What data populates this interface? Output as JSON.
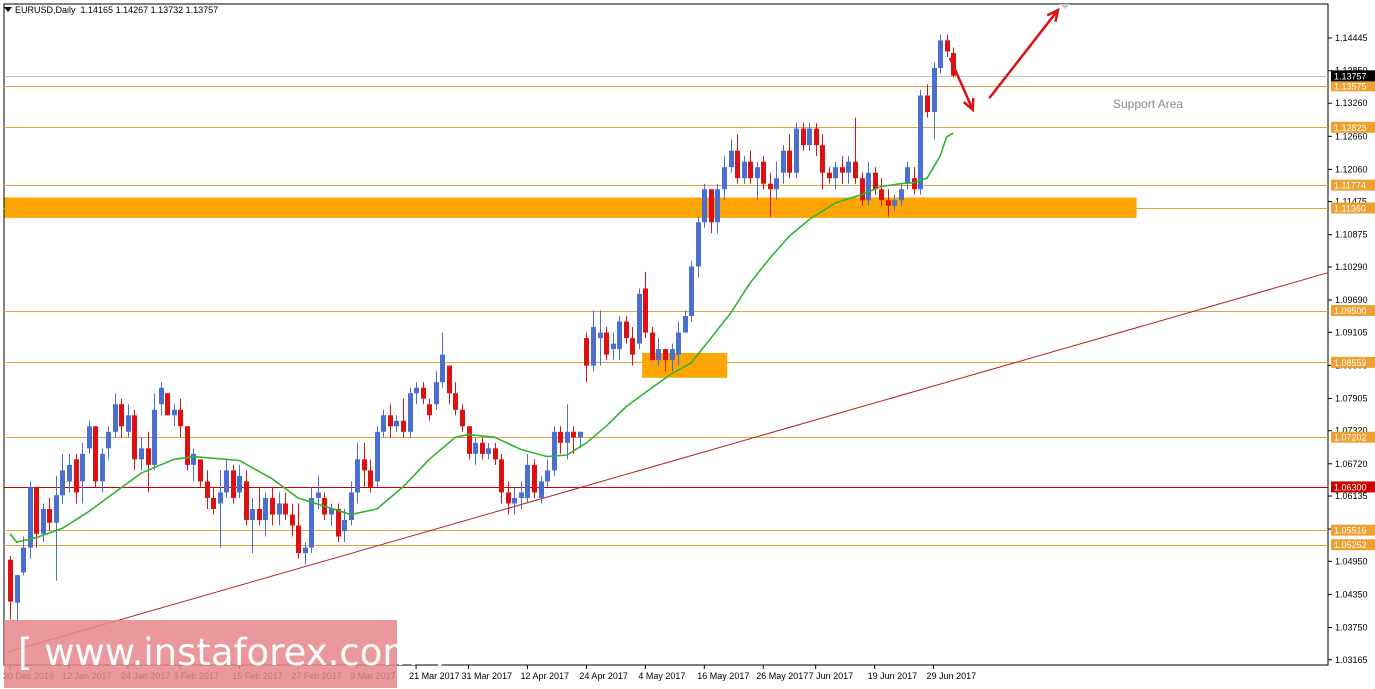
{
  "header": {
    "symbol": "EURUSD,Daily",
    "ohlc": "1.14165 1.14267 1.13732 1.13757"
  },
  "annotation": {
    "support_area": "Support Area"
  },
  "watermark": {
    "text": "[ www.instaforex.com ]"
  },
  "colors": {
    "bull": "#4a6fcf",
    "bear": "#dd1111",
    "ma": "#2fb52f",
    "level_line": "#e8a23c",
    "red_level": "#cc0000",
    "zone": "#ffa500",
    "trendline": "#b22222",
    "arrow": "#dd1111",
    "current_price_tag": "#000000",
    "watermark_bg": "#e8868c"
  },
  "chart_data": {
    "type": "candlestick",
    "title": "EURUSD,Daily",
    "xlabel": "",
    "ylabel": "",
    "ylim": [
      1.0307,
      1.1506
    ],
    "y_ticks": [
      "1.14445",
      "1.13850",
      "1.13260",
      "1.12660",
      "1.12060",
      "1.11475",
      "1.10875",
      "1.10290",
      "1.09690",
      "1.09105",
      "1.08505",
      "1.07905",
      "1.07320",
      "1.06720",
      "1.06135",
      "1.05535",
      "1.04950",
      "1.04350",
      "1.03750",
      "1.03165"
    ],
    "x_ticks": [
      "30 Dec 2016",
      "12 Jan 2017",
      "24 Jan 2017",
      "3 Feb 2017",
      "15 Feb 2017",
      "27 Feb 2017",
      "9 Mar 2017",
      "21 Mar 2017",
      "31 Mar 2017",
      "12 Apr 2017",
      "24 Apr 2017",
      "4 May 2017",
      "16 May 2017",
      "26 May 2017",
      "7 Jun 2017",
      "19 Jun 2017",
      "29 Jun 2017"
    ],
    "x_tick_index": [
      0,
      9,
      18,
      26,
      35,
      44,
      53,
      62,
      70,
      79,
      88,
      97,
      106,
      115,
      123,
      132,
      141
    ],
    "current_price": 1.13757,
    "levels": [
      {
        "price": 1.13575,
        "label": "1.13575",
        "color": "orange"
      },
      {
        "price": 1.12823,
        "label": "1.12823",
        "color": "orange"
      },
      {
        "price": 1.11774,
        "label": "1.11774",
        "color": "orange"
      },
      {
        "price": 1.1136,
        "label": "1.11360",
        "color": "orange"
      },
      {
        "price": 1.095,
        "label": "1.09500",
        "color": "orange"
      },
      {
        "price": 1.08559,
        "label": "1.08559",
        "color": "orange"
      },
      {
        "price": 1.07202,
        "label": "1.07202",
        "color": "orange"
      },
      {
        "price": 1.063,
        "label": "1.06300",
        "color": "red"
      },
      {
        "price": 1.05516,
        "label": "1.05516",
        "color": "orange"
      },
      {
        "price": 1.05252,
        "label": "1.05252",
        "color": "orange"
      }
    ],
    "zones": [
      {
        "i0": -1,
        "i1": 172,
        "y_top": 1.1155,
        "y_bot": 1.1118
      },
      {
        "i0": 96.5,
        "i1": 109.5,
        "y_top": 1.0873,
        "y_bot": 1.0828
      }
    ],
    "trendline": {
      "i0": -0.5,
      "y0": 1.033,
      "i1": 182,
      "y1": 1.0953
    },
    "arrows": [
      {
        "i0": 143.5,
        "y0": 1.1408,
        "i1": 147,
        "y1": 1.1314
      },
      {
        "i0": 149.5,
        "y0": 1.1335,
        "i1": 160,
        "y1": 1.1495
      }
    ],
    "ohlc": [
      [
        1.0498,
        1.0505,
        1.039,
        1.0422
      ],
      [
        1.042,
        1.045,
        1.038,
        1.047
      ],
      [
        1.0475,
        1.054,
        1.047,
        1.052
      ],
      [
        1.052,
        1.064,
        1.05,
        1.063
      ],
      [
        1.063,
        1.062,
        1.052,
        1.0545
      ],
      [
        1.0545,
        1.06,
        1.053,
        1.059
      ],
      [
        1.059,
        1.061,
        1.055,
        1.0565
      ],
      [
        1.0565,
        1.065,
        1.046,
        1.0615
      ],
      [
        1.0615,
        1.069,
        1.06,
        1.066
      ],
      [
        1.064,
        1.069,
        1.062,
        1.067
      ],
      [
        1.068,
        1.069,
        1.06,
        1.062
      ],
      [
        1.064,
        1.071,
        1.06,
        1.069
      ],
      [
        1.07,
        1.075,
        1.069,
        1.074
      ],
      [
        1.074,
        1.073,
        1.063,
        1.064
      ],
      [
        1.064,
        1.07,
        1.062,
        1.069
      ],
      [
        1.07,
        1.074,
        1.068,
        1.073
      ],
      [
        1.073,
        1.08,
        1.072,
        1.078
      ],
      [
        1.078,
        1.079,
        1.072,
        1.074
      ],
      [
        1.073,
        1.078,
        1.072,
        1.076
      ],
      [
        1.076,
        1.077,
        1.066,
        1.068
      ],
      [
        1.068,
        1.072,
        1.066,
        1.07
      ],
      [
        1.07,
        1.073,
        1.062,
        1.067
      ],
      [
        1.067,
        1.08,
        1.066,
        1.077
      ],
      [
        1.078,
        1.082,
        1.076,
        1.081
      ],
      [
        1.08,
        1.079,
        1.076,
        1.076
      ],
      [
        1.076,
        1.078,
        1.074,
        1.077
      ],
      [
        1.077,
        1.079,
        1.072,
        1.074
      ],
      [
        1.074,
        1.072,
        1.066,
        1.067
      ],
      [
        1.067,
        1.07,
        1.064,
        1.069
      ],
      [
        1.068,
        1.068,
        1.063,
        1.064
      ],
      [
        1.064,
        1.066,
        1.059,
        1.061
      ],
      [
        1.061,
        1.063,
        1.058,
        1.059
      ],
      [
        1.06,
        1.066,
        1.052,
        1.062
      ],
      [
        1.062,
        1.068,
        1.061,
        1.066
      ],
      [
        1.066,
        1.067,
        1.06,
        1.061
      ],
      [
        1.062,
        1.067,
        1.061,
        1.065
      ],
      [
        1.064,
        1.066,
        1.056,
        1.057
      ],
      [
        1.057,
        1.061,
        1.051,
        1.059
      ],
      [
        1.059,
        1.063,
        1.056,
        1.057
      ],
      [
        1.057,
        1.062,
        1.054,
        1.061
      ],
      [
        1.061,
        1.063,
        1.056,
        1.058
      ],
      [
        1.058,
        1.062,
        1.056,
        1.06
      ],
      [
        1.06,
        1.062,
        1.057,
        1.058
      ],
      [
        1.058,
        1.06,
        1.054,
        1.056
      ],
      [
        1.056,
        1.06,
        1.05,
        1.051
      ],
      [
        1.051,
        1.053,
        1.049,
        1.052
      ],
      [
        1.052,
        1.063,
        1.051,
        1.061
      ],
      [
        1.061,
        1.065,
        1.059,
        1.062
      ],
      [
        1.061,
        1.062,
        1.057,
        1.058
      ],
      [
        1.058,
        1.06,
        1.056,
        1.059
      ],
      [
        1.059,
        1.06,
        1.053,
        1.054
      ],
      [
        1.055,
        1.059,
        1.053,
        1.057
      ],
      [
        1.057,
        1.064,
        1.056,
        1.062
      ],
      [
        1.062,
        1.071,
        1.06,
        1.068
      ],
      [
        1.068,
        1.071,
        1.063,
        1.066
      ],
      [
        1.066,
        1.068,
        1.062,
        1.063
      ],
      [
        1.064,
        1.074,
        1.063,
        1.073
      ],
      [
        1.073,
        1.077,
        1.072,
        1.076
      ],
      [
        1.076,
        1.078,
        1.072,
        1.074
      ],
      [
        1.074,
        1.076,
        1.073,
        1.075
      ],
      [
        1.075,
        1.079,
        1.072,
        1.073
      ],
      [
        1.073,
        1.081,
        1.072,
        1.08
      ],
      [
        1.08,
        1.082,
        1.078,
        1.081
      ],
      [
        1.081,
        1.082,
        1.078,
        1.079
      ],
      [
        1.078,
        1.079,
        1.075,
        1.076
      ],
      [
        1.078,
        1.084,
        1.077,
        1.082
      ],
      [
        1.082,
        1.091,
        1.081,
        1.087
      ],
      [
        1.085,
        1.085,
        1.078,
        1.08
      ],
      [
        1.08,
        1.082,
        1.076,
        1.077
      ],
      [
        1.077,
        1.078,
        1.073,
        1.074
      ],
      [
        1.074,
        1.074,
        1.068,
        1.069
      ],
      [
        1.069,
        1.072,
        1.067,
        1.071
      ],
      [
        1.071,
        1.072,
        1.068,
        1.069
      ],
      [
        1.069,
        1.071,
        1.068,
        1.07
      ],
      [
        1.07,
        1.071,
        1.067,
        1.068
      ],
      [
        1.068,
        1.069,
        1.06,
        1.062
      ],
      [
        1.062,
        1.064,
        1.058,
        1.06
      ],
      [
        1.06,
        1.063,
        1.058,
        1.061
      ],
      [
        1.061,
        1.064,
        1.059,
        1.062
      ],
      [
        1.061,
        1.069,
        1.06,
        1.067
      ],
      [
        1.067,
        1.068,
        1.061,
        1.062
      ],
      [
        1.061,
        1.065,
        1.06,
        1.064
      ],
      [
        1.064,
        1.068,
        1.063,
        1.066
      ],
      [
        1.066,
        1.074,
        1.065,
        1.073
      ],
      [
        1.073,
        1.074,
        1.069,
        1.071
      ],
      [
        1.071,
        1.078,
        1.068,
        1.073
      ],
      [
        1.073,
        1.074,
        1.069,
        1.072
      ],
      [
        1.072,
        1.073,
        1.07,
        1.073
      ],
      [
        1.09,
        1.091,
        1.082,
        1.085
      ],
      [
        1.085,
        1.095,
        1.084,
        1.092
      ],
      [
        1.09,
        1.095,
        1.085,
        1.091
      ],
      [
        1.091,
        1.092,
        1.086,
        1.087
      ],
      [
        1.088,
        1.091,
        1.086,
        1.089
      ],
      [
        1.088,
        1.094,
        1.086,
        1.093
      ],
      [
        1.093,
        1.094,
        1.089,
        1.09
      ],
      [
        1.09,
        1.092,
        1.085,
        1.087
      ],
      [
        1.089,
        1.099,
        1.088,
        1.098
      ],
      [
        1.099,
        1.102,
        1.09,
        1.091
      ],
      [
        1.091,
        1.092,
        1.086,
        1.086
      ],
      [
        1.086,
        1.09,
        1.085,
        1.088
      ],
      [
        1.088,
        1.088,
        1.084,
        1.086
      ],
      [
        1.086,
        1.089,
        1.084,
        1.088
      ],
      [
        1.087,
        1.093,
        1.085,
        1.091
      ],
      [
        1.091,
        1.095,
        1.091,
        1.094
      ],
      [
        1.094,
        1.104,
        1.093,
        1.103
      ],
      [
        1.103,
        1.112,
        1.101,
        1.111
      ],
      [
        1.111,
        1.118,
        1.11,
        1.117
      ],
      [
        1.117,
        1.115,
        1.109,
        1.111
      ],
      [
        1.111,
        1.118,
        1.109,
        1.117
      ],
      [
        1.117,
        1.123,
        1.115,
        1.121
      ],
      [
        1.121,
        1.126,
        1.12,
        1.124
      ],
      [
        1.124,
        1.127,
        1.118,
        1.119
      ],
      [
        1.119,
        1.123,
        1.118,
        1.122
      ],
      [
        1.122,
        1.124,
        1.118,
        1.119
      ],
      [
        1.119,
        1.122,
        1.115,
        1.121
      ],
      [
        1.122,
        1.123,
        1.117,
        1.118
      ],
      [
        1.118,
        1.12,
        1.112,
        1.117
      ],
      [
        1.117,
        1.122,
        1.115,
        1.119
      ],
      [
        1.12,
        1.125,
        1.118,
        1.124
      ],
      [
        1.124,
        1.127,
        1.119,
        1.12
      ],
      [
        1.12,
        1.129,
        1.119,
        1.128
      ],
      [
        1.128,
        1.129,
        1.124,
        1.125
      ],
      [
        1.125,
        1.129,
        1.124,
        1.128
      ],
      [
        1.128,
        1.129,
        1.123,
        1.125
      ],
      [
        1.125,
        1.127,
        1.117,
        1.12
      ],
      [
        1.12,
        1.121,
        1.118,
        1.119
      ],
      [
        1.119,
        1.122,
        1.117,
        1.121
      ],
      [
        1.121,
        1.123,
        1.118,
        1.12
      ],
      [
        1.12,
        1.123,
        1.118,
        1.122
      ],
      [
        1.122,
        1.13,
        1.118,
        1.119
      ],
      [
        1.119,
        1.12,
        1.114,
        1.115
      ],
      [
        1.115,
        1.122,
        1.114,
        1.12
      ],
      [
        1.12,
        1.121,
        1.116,
        1.117
      ],
      [
        1.117,
        1.119,
        1.114,
        1.115
      ],
      [
        1.115,
        1.117,
        1.112,
        1.114
      ],
      [
        1.114,
        1.116,
        1.113,
        1.115
      ],
      [
        1.115,
        1.118,
        1.114,
        1.117
      ],
      [
        1.118,
        1.122,
        1.117,
        1.121
      ],
      [
        1.119,
        1.121,
        1.116,
        1.117
      ],
      [
        1.117,
        1.135,
        1.116,
        1.134
      ],
      [
        1.134,
        1.136,
        1.13,
        1.131
      ],
      [
        1.131,
        1.14,
        1.126,
        1.139
      ],
      [
        1.139,
        1.145,
        1.138,
        1.144
      ],
      [
        1.144,
        1.145,
        1.141,
        1.142
      ],
      [
        1.1417,
        1.1427,
        1.1373,
        1.1376
      ]
    ],
    "ma": [
      [
        0,
        1.0545
      ],
      [
        1,
        1.053
      ],
      [
        4,
        1.0538
      ],
      [
        8,
        1.0555
      ],
      [
        12,
        1.0585
      ],
      [
        16,
        1.062
      ],
      [
        20,
        1.0655
      ],
      [
        25,
        1.068
      ],
      [
        28,
        1.0685
      ],
      [
        30,
        1.0683
      ],
      [
        35,
        1.0678
      ],
      [
        40,
        1.0645
      ],
      [
        44,
        1.061
      ],
      [
        48,
        1.0595
      ],
      [
        52,
        1.058
      ],
      [
        56,
        1.059
      ],
      [
        60,
        1.063
      ],
      [
        64,
        1.068
      ],
      [
        68,
        1.072
      ],
      [
        70,
        1.0725
      ],
      [
        74,
        1.072
      ],
      [
        78,
        1.0698
      ],
      [
        82,
        1.0685
      ],
      [
        85,
        1.0688
      ],
      [
        88,
        1.071
      ],
      [
        91,
        1.074
      ],
      [
        94,
        1.0775
      ],
      [
        98,
        1.081
      ],
      [
        101,
        1.0835
      ],
      [
        104,
        1.0855
      ],
      [
        107,
        1.09
      ],
      [
        110,
        1.0945
      ],
      [
        113,
        1.1
      ],
      [
        116,
        1.1045
      ],
      [
        119,
        1.1085
      ],
      [
        122,
        1.1115
      ],
      [
        126,
        1.1145
      ],
      [
        130,
        1.116
      ],
      [
        133,
        1.1175
      ],
      [
        136,
        1.118
      ],
      [
        138,
        1.1182
      ],
      [
        140,
        1.119
      ],
      [
        142,
        1.123
      ],
      [
        143,
        1.1265
      ],
      [
        144,
        1.1272
      ]
    ]
  }
}
